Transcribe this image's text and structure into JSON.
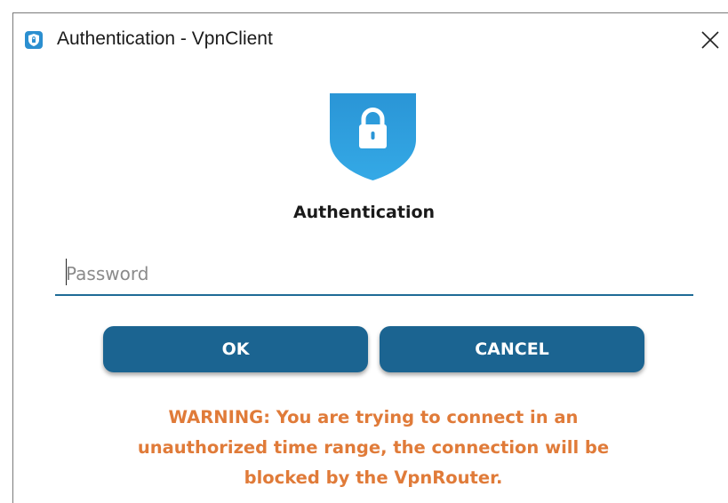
{
  "window": {
    "title": "Authentication - VpnClient",
    "close_icon": "close-icon",
    "app_icon": "shield-app-icon"
  },
  "main": {
    "logo_icon": "shield-lock-icon",
    "heading": "Authentication",
    "password": {
      "value": "",
      "placeholder": "Password"
    },
    "ok_label": "OK",
    "cancel_label": "CANCEL",
    "warning_lines": [
      "WARNING: You are trying to connect in an",
      "unauthorized time range, the connection will be",
      "blocked by the VpnRouter."
    ]
  },
  "colors": {
    "accent": "#1b6491",
    "shield": "#2da0e0",
    "warning": "#e07b39",
    "input_underline": "#1e6b96"
  }
}
